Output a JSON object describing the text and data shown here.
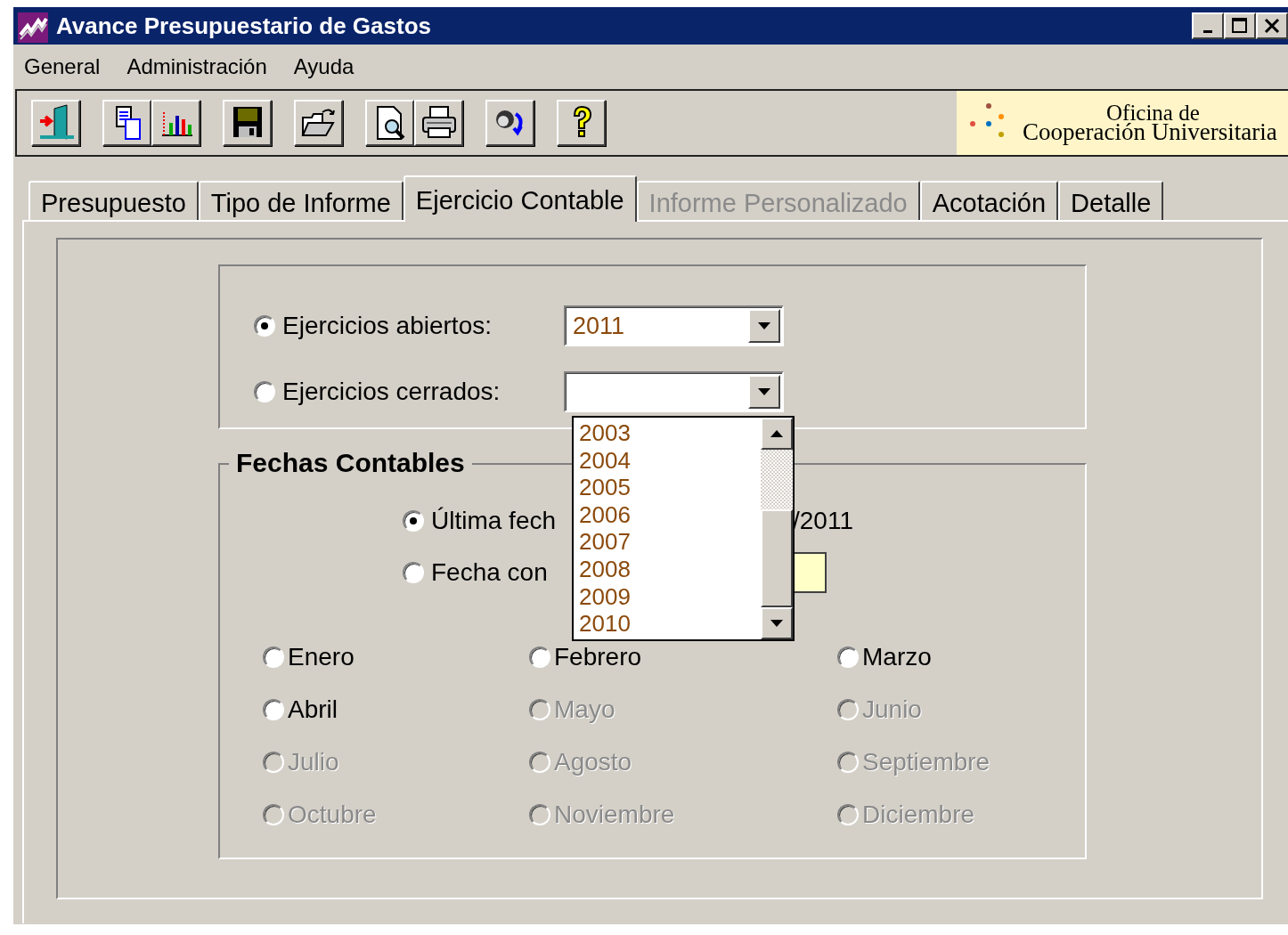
{
  "window": {
    "title": "Avance Presupuestario de Gastos"
  },
  "menu": [
    "General",
    "Administración",
    "Ayuda"
  ],
  "logo": {
    "line_1": "Oficina de",
    "line_2": "Cooperación Universitaria"
  },
  "tabs": [
    {
      "label": "Presupuesto",
      "selected": false,
      "disabled": false
    },
    {
      "label": "Tipo de Informe",
      "selected": false,
      "disabled": false
    },
    {
      "label": "Ejercicio Contable",
      "selected": true,
      "disabled": false
    },
    {
      "label": "Informe Personalizado",
      "selected": false,
      "disabled": true
    },
    {
      "label": "Acotación",
      "selected": false,
      "disabled": false
    },
    {
      "label": "Detalle",
      "selected": false,
      "disabled": false
    }
  ],
  "ejercicios": [
    {
      "label": "Ejercicios abiertos:",
      "selected": true,
      "value": "2011"
    },
    {
      "label": "Ejercicios cerrados:",
      "selected": false
    }
  ],
  "dropdown_list": [
    "2003",
    "2004",
    "2005",
    "2006",
    "2007",
    "2008",
    "2009",
    "2010"
  ],
  "fechas": {
    "title": "Fechas Contables",
    "options": [
      {
        "kind": "text",
        "label": "Última fech",
        "selected": true,
        "trailing": "/2011"
      },
      {
        "kind": "field",
        "label": "Fecha con",
        "selected": false
      }
    ],
    "months": [
      {
        "label": "Enero",
        "selected": false,
        "disabled": false
      },
      {
        "label": "Febrero",
        "selected": false,
        "disabled": false
      },
      {
        "label": "Marzo",
        "selected": false,
        "disabled": false
      },
      {
        "label": "Abril",
        "selected": false,
        "disabled": false
      },
      {
        "label": "Mayo",
        "selected": false,
        "disabled": true
      },
      {
        "label": "Junio",
        "selected": false,
        "disabled": true
      },
      {
        "label": "Julio",
        "selected": false,
        "disabled": true
      },
      {
        "label": "Agosto",
        "selected": false,
        "disabled": true
      },
      {
        "label": "Septiembre",
        "selected": false,
        "disabled": true
      },
      {
        "label": "Octubre",
        "selected": false,
        "disabled": true
      },
      {
        "label": "Noviembre",
        "selected": false,
        "disabled": true
      },
      {
        "label": "Diciembre",
        "selected": false,
        "disabled": true
      }
    ]
  }
}
